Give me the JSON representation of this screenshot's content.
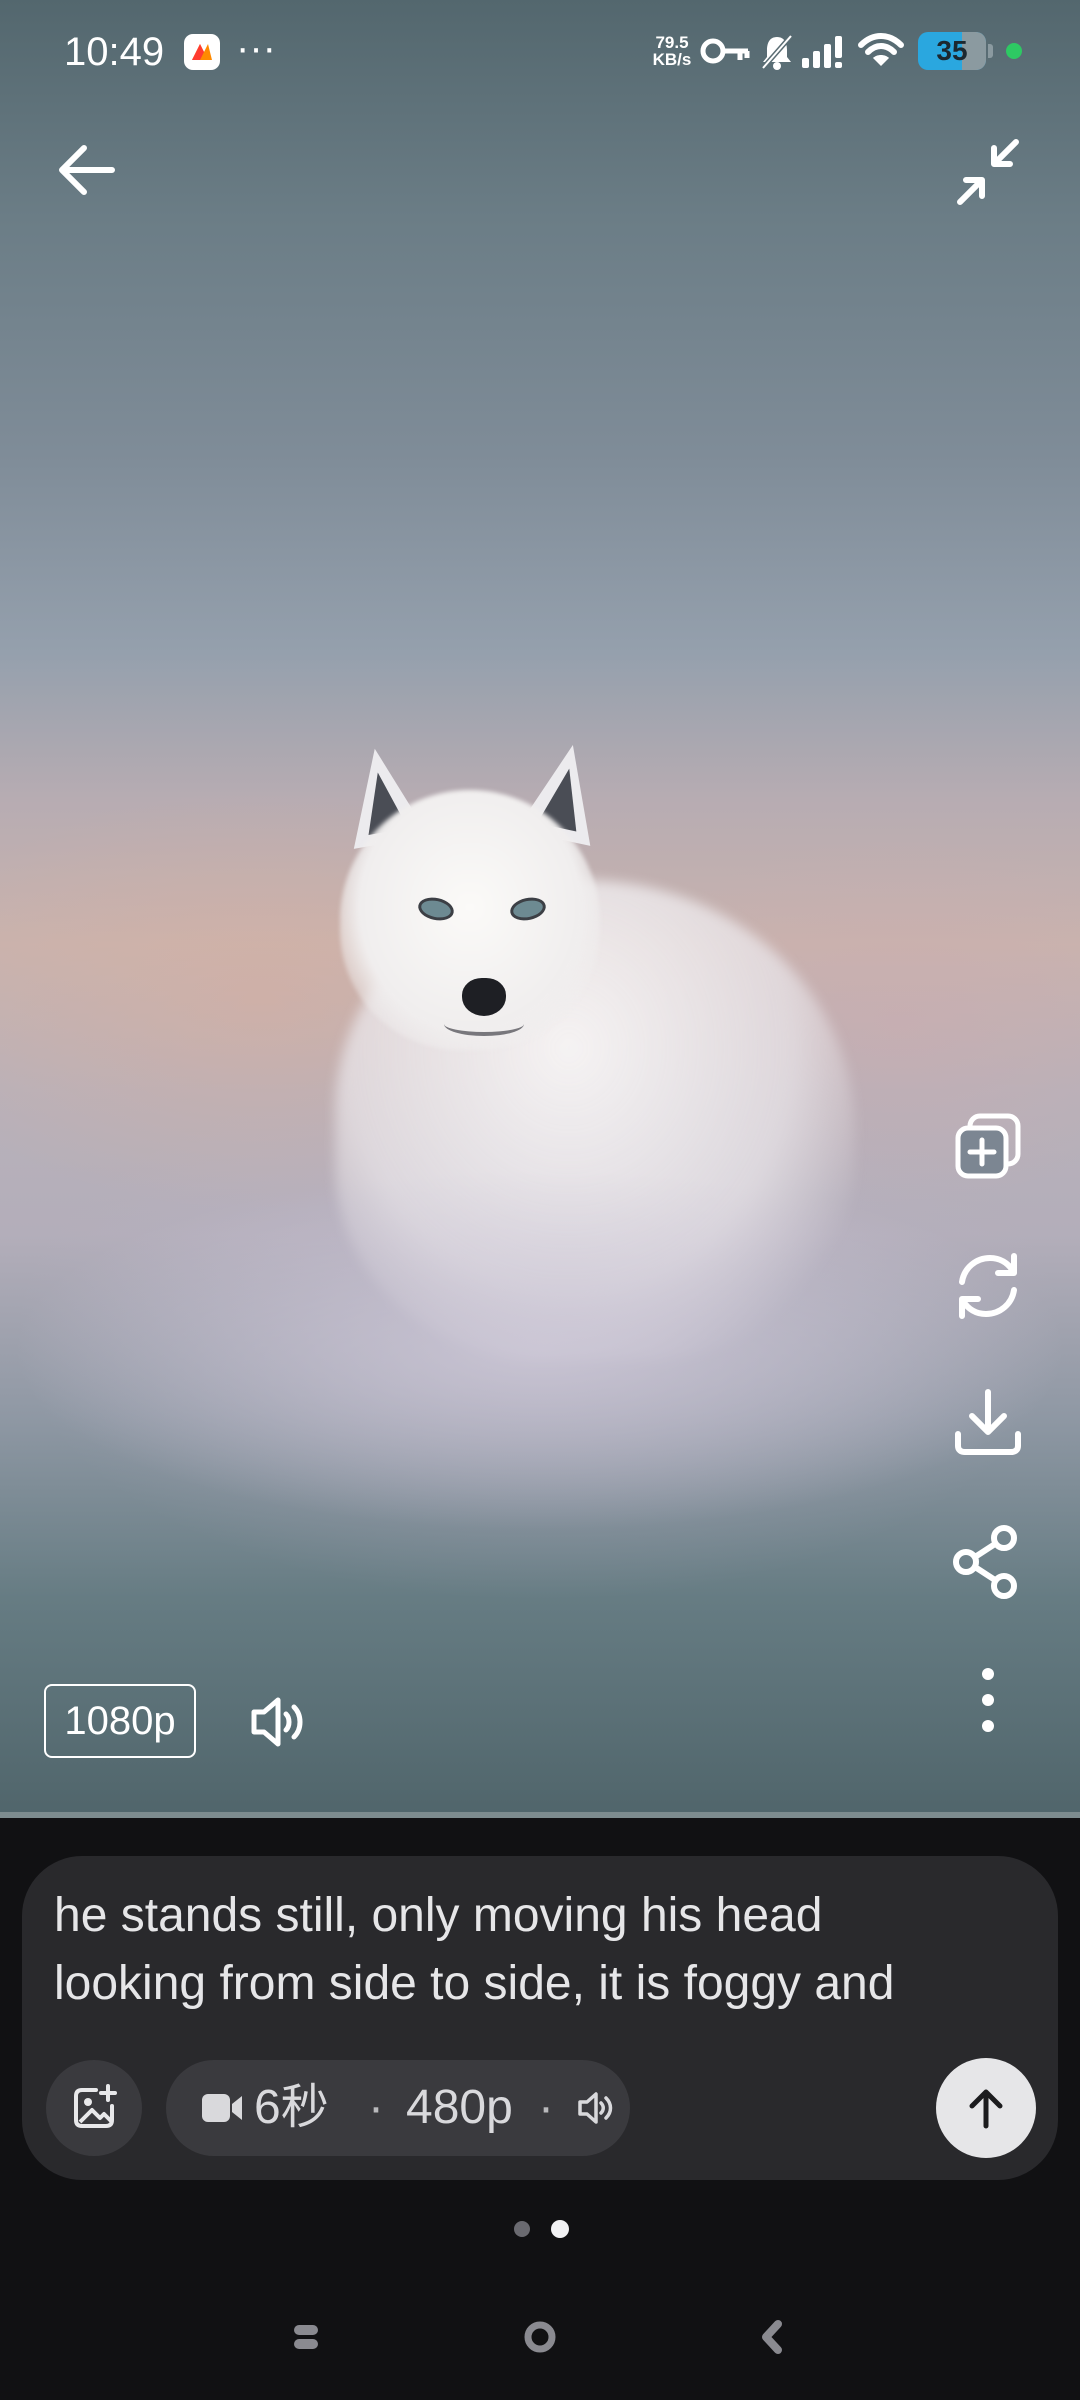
{
  "status_bar": {
    "time": "10:49",
    "more_indicator": "···",
    "net_speed_value": "79.5",
    "net_speed_unit": "KB/s",
    "battery_level": "35",
    "icons": [
      "app-notification-icon",
      "vpn-key-icon",
      "bell-muted-icon",
      "signal-icon",
      "wifi-icon",
      "battery-icon",
      "active-dot-icon"
    ]
  },
  "top_bar": {
    "icons": [
      "back-arrow-icon",
      "collapse-fullscreen-icon"
    ]
  },
  "action_rail": {
    "icons": [
      "duplicate-add-icon",
      "regenerate-icon",
      "download-icon",
      "share-icon",
      "more-vertical-icon"
    ]
  },
  "player": {
    "quality_label": "1080p",
    "volume_icon": "speaker-icon"
  },
  "composer": {
    "prompt_line_1": "he stands still, only moving his head",
    "prompt_line_2": "looking from side to side, it is foggy and",
    "duration": "6秒",
    "separator": "·",
    "resolution": "480p",
    "icons": [
      "image-add-icon",
      "video-camera-icon",
      "speaker-icon",
      "send-arrow-icon"
    ]
  },
  "pager": {
    "count": 2,
    "active_index": 1
  },
  "nav_bar": {
    "icons": [
      "recents-icon",
      "home-icon",
      "back-icon"
    ]
  },
  "colors": {
    "composer_bg": "#29292c",
    "pill_bg": "#3a3a3e",
    "battery_fill": "#2aa7df",
    "active_dot": "#2ec963"
  }
}
